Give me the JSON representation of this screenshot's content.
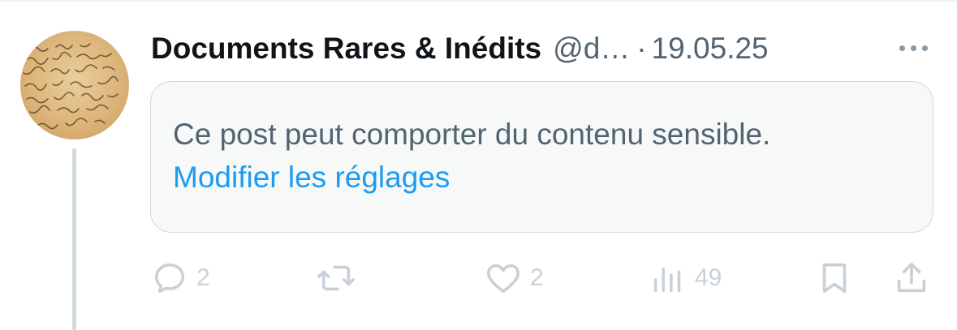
{
  "post": {
    "author_name": "Documents Rares & Inédits",
    "handle": "@d…",
    "separator": "·",
    "date": "19.05.25",
    "warning_text": "Ce post peut comporter du contenu sensible.",
    "settings_link": "Modifier les réglages"
  },
  "actions": {
    "reply_count": "2",
    "like_count": "2",
    "views_count": "49"
  },
  "icons": {
    "more": "more-options-icon",
    "reply": "reply-icon",
    "repost": "repost-icon",
    "like": "heart-icon",
    "views": "views-chart-icon",
    "bookmark": "bookmark-icon",
    "share": "share-icon"
  },
  "colors": {
    "primary_text": "#0f1419",
    "secondary_text": "#536471",
    "link": "#1d9bf0",
    "action_icons": "#c9d1d8",
    "card_background": "#f7f9f9",
    "card_border": "#cfd9de",
    "thread_line": "#cfd9de"
  }
}
